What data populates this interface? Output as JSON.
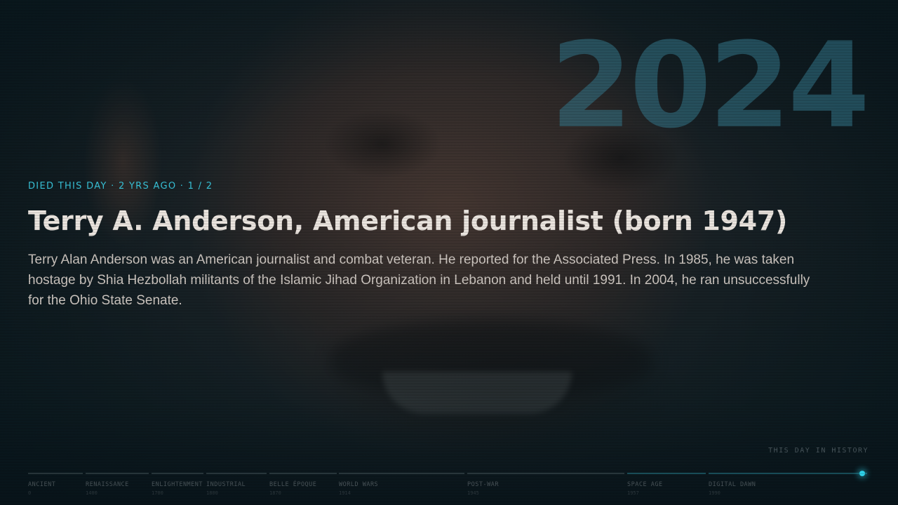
{
  "event": {
    "eyebrow": "DIED THIS DAY · 2 YRS AGO · 1 / 2",
    "year": "2024",
    "title": "Terry A. Anderson, American journalist (born 1947)",
    "description": "Terry Alan Anderson was an American journalist and combat veteran. He reported for the Associated Press. In 1985, he was taken hostage by Shia Hezbollah militants of the Islamic Jihad Organization in Lebanon and held until 1991. In 2004, he ran unsuccessfully for the Ohio State Senate."
  },
  "corner_label": "THIS DAY IN HISTORY",
  "timeline": {
    "eras": [
      {
        "label": "ANCIENT",
        "year": "0"
      },
      {
        "label": "RENAISSANCE",
        "year": "1400"
      },
      {
        "label": "ENLIGHTENMENT",
        "year": "1700"
      },
      {
        "label": "INDUSTRIAL",
        "year": "1800"
      },
      {
        "label": "BELLE ÉPOQUE",
        "year": "1870"
      },
      {
        "label": "WORLD WARS",
        "year": "1914"
      },
      {
        "label": "POST-WAR",
        "year": "1945"
      },
      {
        "label": "SPACE AGE",
        "year": "1957"
      },
      {
        "label": "DIGITAL DAWN",
        "year": "1990"
      }
    ],
    "accent_color": "#2fd3ea"
  }
}
